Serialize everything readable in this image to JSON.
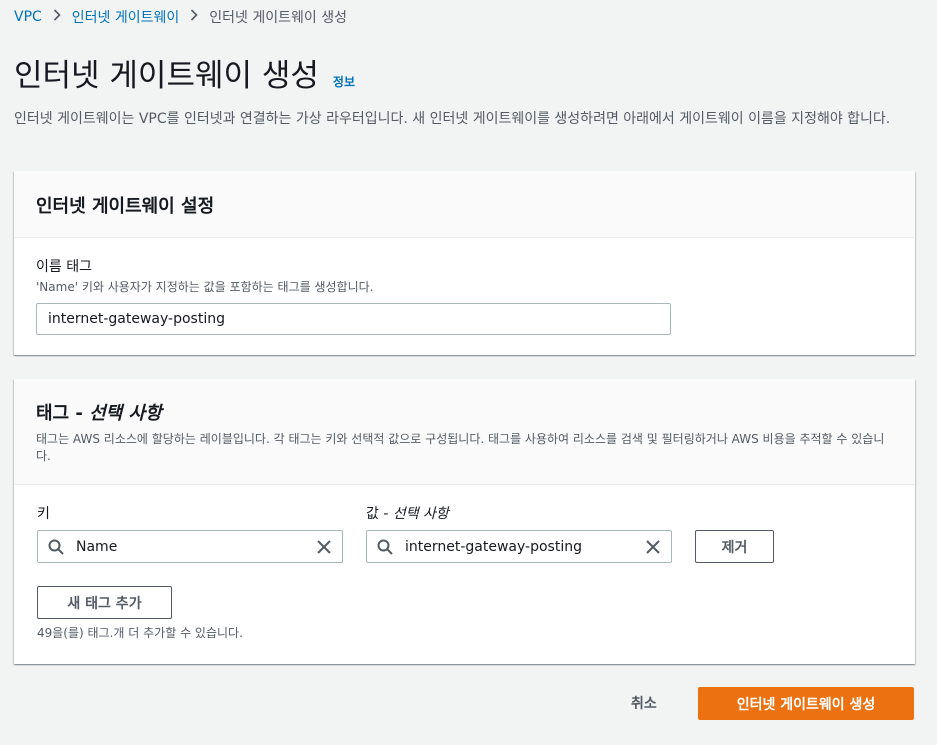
{
  "breadcrumb": {
    "items": [
      "VPC",
      "인터넷 게이트웨이",
      "인터넷 게이트웨이 생성"
    ]
  },
  "page": {
    "title": "인터넷 게이트웨이 생성",
    "info_link": "정보",
    "description": "인터넷 게이트웨이는 VPC를 인터넷과 연결하는 가상 라우터입니다. 새 인터넷 게이트웨이를 생성하려면 아래에서 게이트웨이 이름을 지정해야 합니다."
  },
  "settings_panel": {
    "title": "인터넷 게이트웨이 설정",
    "name_tag_label": "이름 태그",
    "name_tag_desc": "'Name' 키와 사용자가 지정하는 값을 포함하는 태그를 생성합니다.",
    "name_tag_value": "internet-gateway-posting"
  },
  "tags_panel": {
    "title_main": "태그 - ",
    "title_optional": "선택 사항",
    "description": "태그는 AWS 리소스에 할당하는 레이블입니다. 각 태그는 키와 선택적 값으로 구성됩니다. 태그를 사용하여 리소스를 검색 및 필터링하거나 AWS 비용을 추적할 수 있습니다.",
    "key_label": "키",
    "value_label_main": "값 - ",
    "value_label_optional": "선택 사항",
    "tag": {
      "key": "Name",
      "value": "internet-gateway-posting"
    },
    "remove_button": "제거",
    "add_button": "새 태그 추가",
    "limit_note": "49을(를) 태그.개 더 추가할 수 있습니다."
  },
  "footer": {
    "cancel": "취소",
    "create": "인터넷 게이트웨이 생성"
  },
  "icons": {
    "search": "search-icon",
    "clear": "close-icon",
    "separator": "chevron-right-icon"
  },
  "colors": {
    "link": "#0073bb",
    "primary": "#ec7211",
    "background": "#f2f3f3"
  }
}
